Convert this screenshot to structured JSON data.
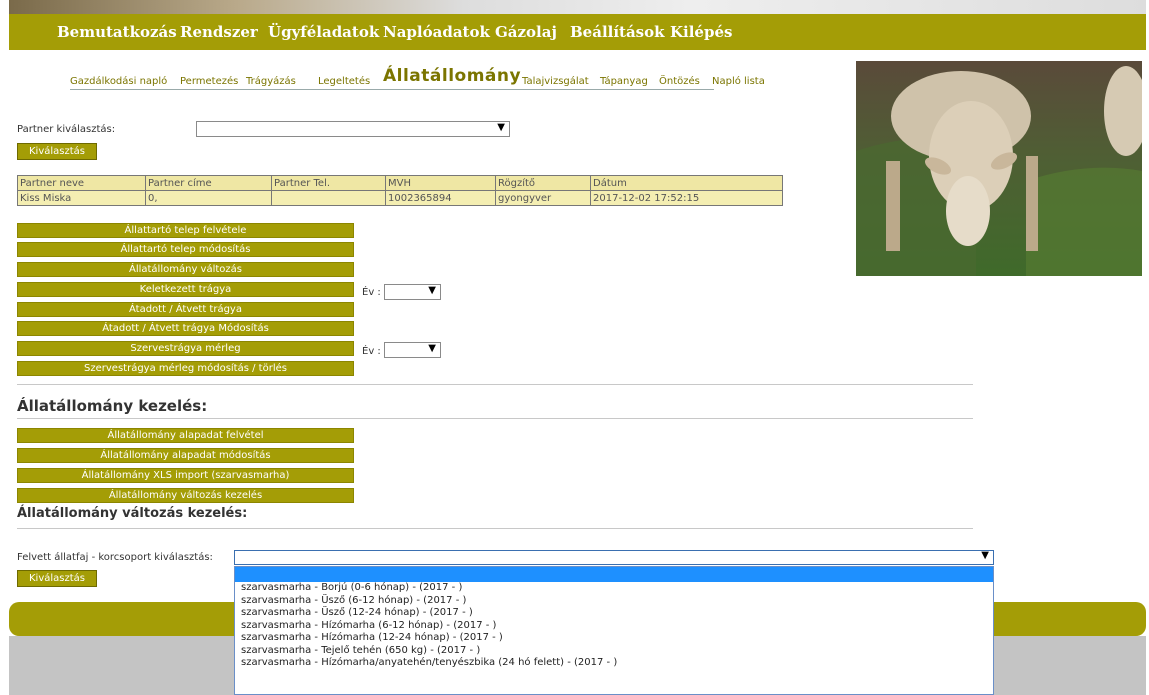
{
  "menu": [
    "Bemutatkozás",
    "Rendszer",
    "Ügyféladatok",
    "Naplóadatok",
    "Gázolaj",
    "Beállítások",
    "Kilépés"
  ],
  "submenu": {
    "items": [
      "Gazdálkodási napló",
      "Permetezés",
      "Trágyázás",
      "Legeltetés",
      "Állatállomány",
      "Talajvizsgálat",
      "Tápanyag",
      "Öntözés",
      "Napló lista"
    ],
    "active": "Állatállomány"
  },
  "partner": {
    "label": "Partner kiválasztás:",
    "select_value": "",
    "button": "Kiválasztás"
  },
  "table": {
    "headers": [
      "Partner neve",
      "Partner címe",
      "Partner Tel.",
      "MVH",
      "Rögzítő",
      "Dátum"
    ],
    "rows": [
      [
        "Kiss Miska",
        "0,",
        "",
        "1002365894",
        "gyongyver",
        "2017-12-02 17:52:15"
      ]
    ]
  },
  "actions": [
    "Állattartó telep felvétele",
    "Állattartó telep módosítás",
    "Állatállomány változás",
    "Keletkezett trágya",
    "Átadott / Átvett trágya",
    "Átadott / Átvett trágya Módosítás",
    "Szervestrágya mérleg",
    "Szervestrágya mérleg módosítás / törlés"
  ],
  "year": {
    "label": "Év :",
    "value": ""
  },
  "section1": {
    "title": "Állatállomány kezelés:",
    "buttons": [
      "Állatállomány alapadat felvétel",
      "Állatállomány alapadat módosítás",
      "Állatállomány XLS import (szarvasmarha)",
      "Állatállomány változás kezelés"
    ]
  },
  "section2": {
    "title": "Állatállomány változás kezelés:",
    "label": "Felvett állatfaj - korcsoport kiválasztás:",
    "select_value": "",
    "button": "Kiválasztás"
  },
  "dropdown_options": [
    "",
    "szarvasmarha  -  Borjú (0-6 hónap) -  (2017 -        )",
    "szarvasmarha  -  Üsző (6-12 hónap) -  (2017 -        )",
    "szarvasmarha  -  Üsző (12-24 hónap) -  (2017 -        )",
    "szarvasmarha  -  Hízómarha (6-12 hónap) -  (2017 -        )",
    "szarvasmarha  -  Hízómarha (12-24 hónap) -  (2017 -        )",
    "szarvasmarha  -  Tejelő tehén (650 kg) -  (2017 -        )",
    "szarvasmarha  -  Hízómarha/anyatehén/tenyészbika (24 hó felett) -  (2017 -        )"
  ],
  "icons": {
    "dropdown": "chevron-down-icon",
    "photo": "sheep-photo"
  },
  "colors": {
    "accent": "#a49d06",
    "table_bg": "#f4eeb2",
    "selected_option": "#1e90ff"
  }
}
